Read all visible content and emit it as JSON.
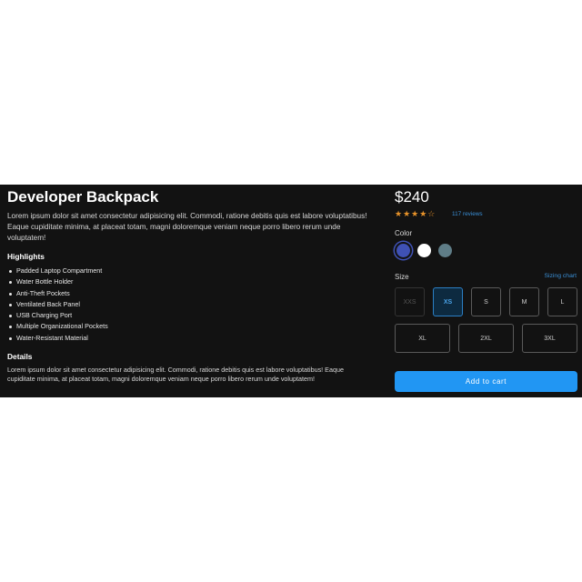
{
  "product": {
    "title": "Developer Backpack",
    "description": "Lorem ipsum dolor sit amet consectetur adipisicing elit. Commodi, ratione debitis quis est labore voluptatibus! Eaque cupiditate minima, at placeat totam, magni doloremque veniam neque porro libero rerum unde voluptatem!",
    "highlights_heading": "Highlights",
    "highlights": [
      "Padded Laptop Compartment",
      "Water Bottle Holder",
      "Anti-Theft Pockets",
      "Ventilated Back Panel",
      "USB Charging Port",
      "Multiple Organizational Pockets",
      "Water-Resistant Material"
    ],
    "details_heading": "Details",
    "details": "Lorem ipsum dolor sit amet consectetur adipisicing elit. Commodi, ratione debitis quis est labore voluptatibus! Eaque cupiditate minima, at placeat totam, magni doloremque veniam neque porro libero rerum unde voluptatem!"
  },
  "purchase": {
    "price": "$240",
    "rating": 4,
    "rating_max": 5,
    "stars_filled": "★★★★",
    "stars_empty": "☆",
    "reviews": "117 reviews",
    "color_label": "Color",
    "colors": [
      {
        "name": "indigo",
        "hex": "#3f51b5",
        "selected": true
      },
      {
        "name": "white",
        "hex": "#ffffff",
        "selected": false
      },
      {
        "name": "slate",
        "hex": "#5f7d87",
        "selected": false
      }
    ],
    "size_label": "Size",
    "sizing_chart": "Sizing chart",
    "sizes": [
      {
        "label": "XXS",
        "state": "disabled"
      },
      {
        "label": "XS",
        "state": "selected"
      },
      {
        "label": "S",
        "state": "default"
      },
      {
        "label": "M",
        "state": "default"
      },
      {
        "label": "L",
        "state": "default"
      },
      {
        "label": "XL",
        "state": "default"
      },
      {
        "label": "2XL",
        "state": "default"
      },
      {
        "label": "3XL",
        "state": "default"
      }
    ],
    "add_to_cart": "Add to cart"
  }
}
